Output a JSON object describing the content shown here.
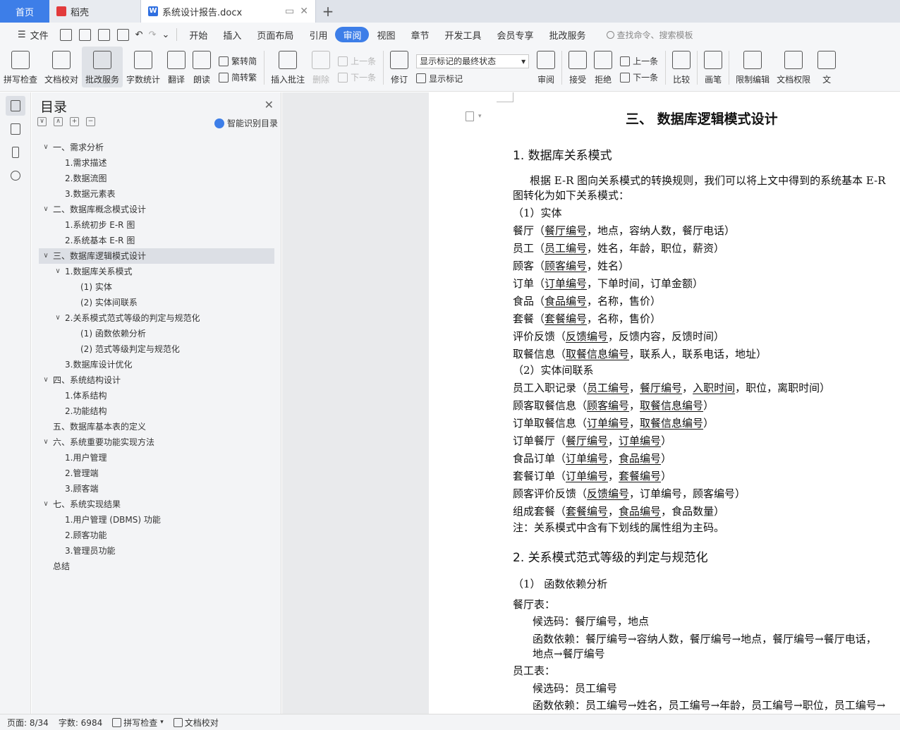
{
  "tabs": {
    "home": "首页",
    "wps": "稻壳",
    "document": "系统设计报告.docx",
    "close": "✕",
    "new_tab": "+"
  },
  "menu": {
    "file": "文件",
    "items": [
      "开始",
      "插入",
      "页面布局",
      "引用",
      "审阅",
      "视图",
      "章节",
      "开发工具",
      "会员专享",
      "批改服务"
    ],
    "active": "审阅",
    "search_placeholder": "查找命令、搜索模板"
  },
  "ribbon": {
    "spell_check": "拼写检查",
    "doc_proofread": "文档校对",
    "revise_service": "批改服务",
    "word_count": "字数统计",
    "translate": "翻译",
    "read_aloud": "朗读",
    "trad_to_simp": "繁转简",
    "simp_to_trad": "简转繁",
    "insert_comment": "插入批注",
    "delete": "删除",
    "previous": "上一条",
    "next": "下一条",
    "track_changes": "修订",
    "markup_mode": "显示标记的最终状态",
    "show_markup": "显示标记",
    "review": "审阅",
    "accept": "接受",
    "reject": "拒绝",
    "prev_change": "上一条",
    "next_change": "下一条",
    "compare": "比较",
    "draw": "画笔",
    "restrict_edit": "限制编辑",
    "doc_permission": "文档权限",
    "doc_more": "文"
  },
  "toc": {
    "title": "目录",
    "smart_recognize": "智能识别目录",
    "items": [
      {
        "label": "一、需求分析",
        "level": 1,
        "chevron": "∨"
      },
      {
        "label": "1.需求描述",
        "level": 2
      },
      {
        "label": "2.数据流图",
        "level": 2
      },
      {
        "label": "3.数据元素表",
        "level": 2
      },
      {
        "label": "二、数据库概念模式设计",
        "level": 1,
        "chevron": "∨"
      },
      {
        "label": "1.系统初步 E-R 图",
        "level": 2
      },
      {
        "label": "2.系统基本 E-R 图",
        "level": 2
      },
      {
        "label": "三、数据库逻辑模式设计",
        "level": 1,
        "chevron": "∨",
        "selected": true
      },
      {
        "label": "1.数据库关系模式",
        "level": 2,
        "chevron": "∨"
      },
      {
        "label": "(1) 实体",
        "level": 3
      },
      {
        "label": "(2) 实体间联系",
        "level": 3
      },
      {
        "label": "2.关系模式范式等级的判定与规范化",
        "level": 2,
        "chevron": "∨"
      },
      {
        "label": "(1) 函数依赖分析",
        "level": 3
      },
      {
        "label": "(2) 范式等级判定与规范化",
        "level": 3
      },
      {
        "label": "3.数据库设计优化",
        "level": 2
      },
      {
        "label": "四、系统结构设计",
        "level": 1,
        "chevron": "∨"
      },
      {
        "label": "1.体系结构",
        "level": 2
      },
      {
        "label": "2.功能结构",
        "level": 2
      },
      {
        "label": "五、数据库基本表的定义",
        "level": 1
      },
      {
        "label": "六、系统重要功能实现方法",
        "level": 1,
        "chevron": "∨"
      },
      {
        "label": "1.用户管理",
        "level": 2
      },
      {
        "label": "2.管理端",
        "level": 2
      },
      {
        "label": "3.顾客端",
        "level": 2
      },
      {
        "label": "七、系统实现结果",
        "level": 1,
        "chevron": "∨"
      },
      {
        "label": "1.用户管理 (DBMS) 功能",
        "level": 2
      },
      {
        "label": "2.顾客功能",
        "level": 2
      },
      {
        "label": "3.管理员功能",
        "level": 2
      },
      {
        "label": "总结",
        "level": 1
      }
    ]
  },
  "doc": {
    "heading": "三、    数据库逻辑模式设计",
    "section1": "1. 数据库关系模式",
    "intro1": "根据 E-R 图向关系模式的转换规则，我们可以将上文中得到的系统基本 E-R",
    "intro2": "图转化为如下关系模式：",
    "entities_title": "（1）实体",
    "entities": [
      [
        {
          "t": "餐厅（"
        },
        {
          "t": "餐厅编号",
          "u": true
        },
        {
          "t": "，地点，容纳人数，餐厅电话）"
        }
      ],
      [
        {
          "t": "员工（"
        },
        {
          "t": "员工编号",
          "u": true
        },
        {
          "t": "，姓名，年龄，职位，薪资）"
        }
      ],
      [
        {
          "t": "顾客（"
        },
        {
          "t": "顾客编号",
          "u": true
        },
        {
          "t": "，姓名）"
        }
      ],
      [
        {
          "t": "订单（"
        },
        {
          "t": "订单编号",
          "u": true
        },
        {
          "t": "，下单时间，订单金额）"
        }
      ],
      [
        {
          "t": "食品（"
        },
        {
          "t": "食品编号",
          "u": true
        },
        {
          "t": "，名称，售价）"
        }
      ],
      [
        {
          "t": "套餐（"
        },
        {
          "t": "套餐编号",
          "u": true
        },
        {
          "t": "，名称，售价）"
        }
      ],
      [
        {
          "t": "评价反馈（"
        },
        {
          "t": "反馈编号",
          "u": true
        },
        {
          "t": "，反馈内容，反馈时间）"
        }
      ],
      [
        {
          "t": "取餐信息（"
        },
        {
          "t": "取餐信息编号",
          "u": true
        },
        {
          "t": "，联系人，联系电话，地址）"
        }
      ]
    ],
    "relations_title": "（2）实体间联系",
    "relations": [
      [
        {
          "t": "员工入职记录（"
        },
        {
          "t": "员工编号",
          "u": true
        },
        {
          "t": "，"
        },
        {
          "t": "餐厅编号",
          "u": true
        },
        {
          "t": "，"
        },
        {
          "t": "入职时间",
          "u": true
        },
        {
          "t": "，职位，离职时间）"
        }
      ],
      [
        {
          "t": "顾客取餐信息（"
        },
        {
          "t": "顾客编号",
          "u": true
        },
        {
          "t": "，"
        },
        {
          "t": "取餐信息编号",
          "u": true
        },
        {
          "t": "）"
        }
      ],
      [
        {
          "t": "订单取餐信息（"
        },
        {
          "t": "订单编号",
          "u": true
        },
        {
          "t": "，"
        },
        {
          "t": "取餐信息编号",
          "u": true
        },
        {
          "t": "）"
        }
      ],
      [
        {
          "t": "订单餐厅（"
        },
        {
          "t": "餐厅编号",
          "u": true
        },
        {
          "t": "，"
        },
        {
          "t": "订单编号",
          "u": true
        },
        {
          "t": "）"
        }
      ],
      [
        {
          "t": "食品订单（"
        },
        {
          "t": "订单编号",
          "u": true
        },
        {
          "t": "，"
        },
        {
          "t": "食品编号",
          "u": true
        },
        {
          "t": "）"
        }
      ],
      [
        {
          "t": "套餐订单（"
        },
        {
          "t": "订单编号",
          "u": true
        },
        {
          "t": "，"
        },
        {
          "t": "套餐编号",
          "u": true
        },
        {
          "t": "）"
        }
      ],
      [
        {
          "t": "顾客评价反馈（"
        },
        {
          "t": "反馈编号",
          "u": true
        },
        {
          "t": "，订单编号，顾客编号）"
        }
      ],
      [
        {
          "t": "组成套餐（"
        },
        {
          "t": "套餐编号",
          "u": true
        },
        {
          "t": "，"
        },
        {
          "t": "食品编号",
          "u": true
        },
        {
          "t": "，食品数量）"
        }
      ]
    ],
    "note": "注：关系模式中含有下划线的属性组为主码。",
    "section2": "2. 关系模式范式等级的判定与规范化",
    "sub1": "（1）  函数依赖分析",
    "restaurant_table": "餐厅表：",
    "restaurant_candidate": "候选码：餐厅编号，地点",
    "restaurant_fd": "函数依赖：餐厅编号→容纳人数，餐厅编号→地点，餐厅编号→餐厅电话，",
    "restaurant_fd2": "地点→餐厅编号",
    "employee_table": "员工表：",
    "employee_candidate": "候选码：员工编号",
    "employee_fd": "函数依赖：员工编号→姓名，员工编号→年龄，员工编号→职位，员工编号→"
  },
  "status": {
    "page": "页面: 8/34",
    "words": "字数: 6984",
    "spell": "拼写检查",
    "proof": "文档校对"
  }
}
